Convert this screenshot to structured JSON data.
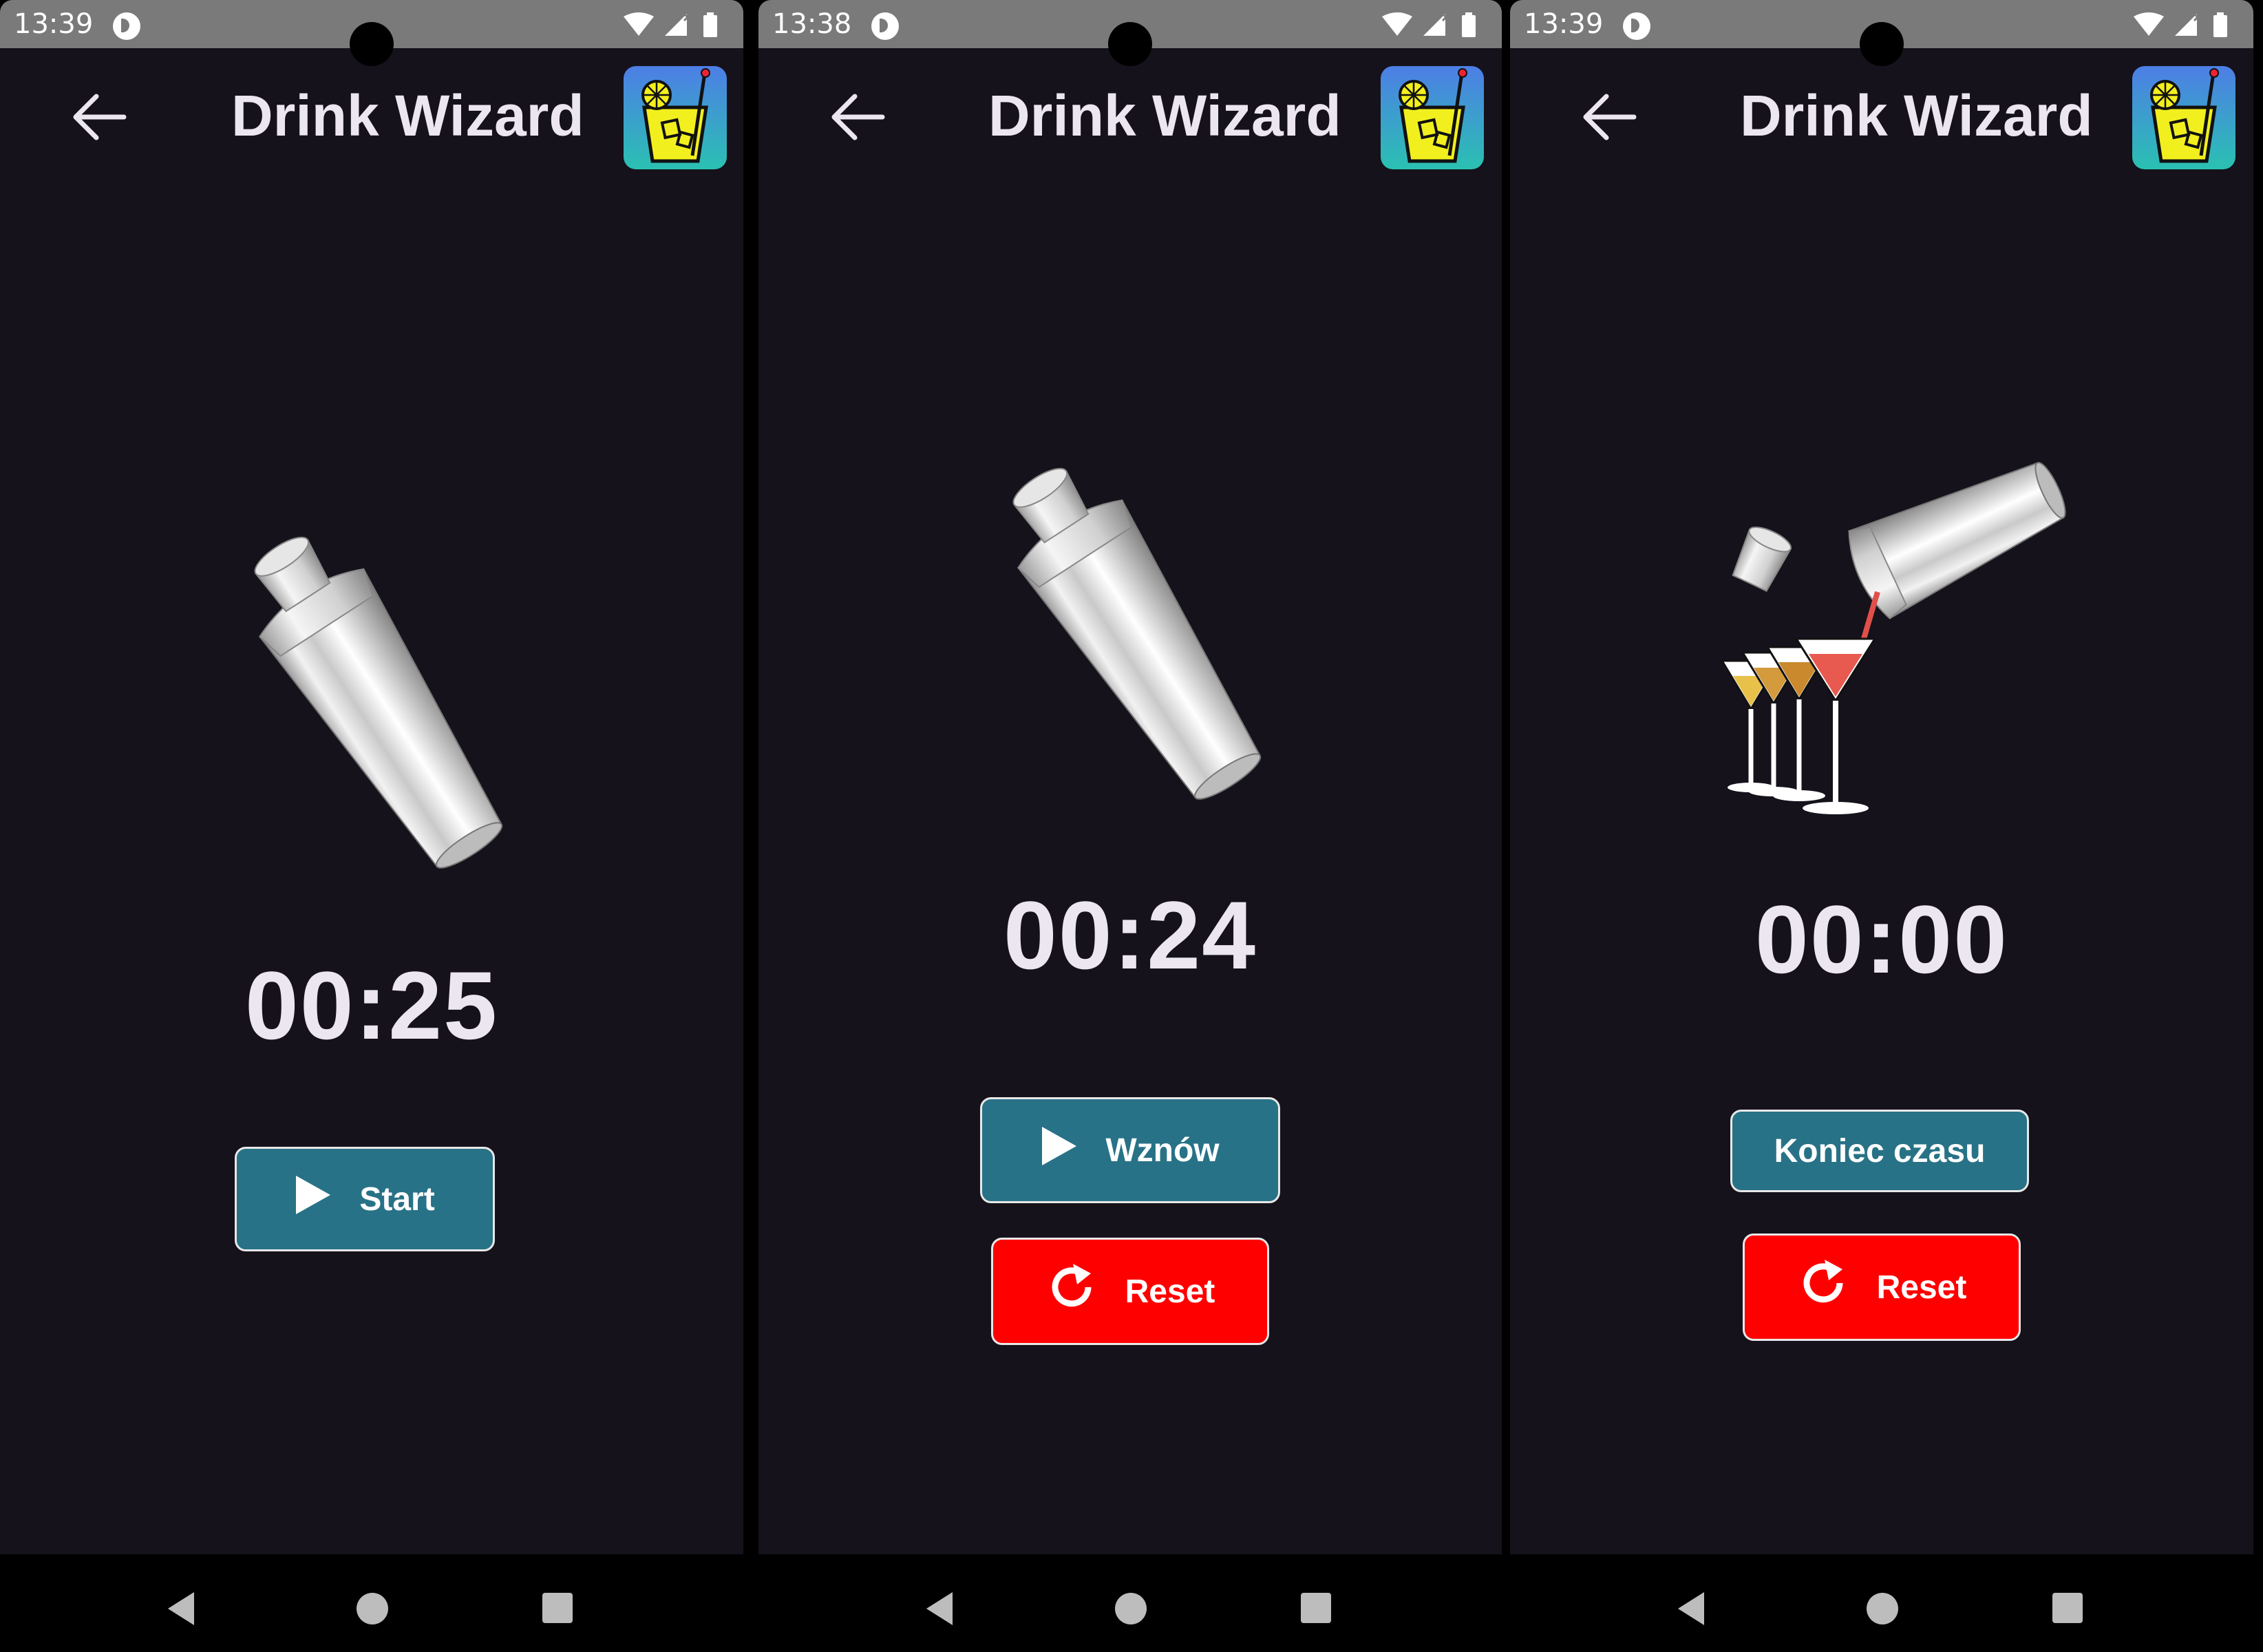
{
  "app": {
    "title": "Drink Wizard"
  },
  "screens": [
    {
      "status_time": "13:39",
      "timer": "00:25",
      "primary_label": "Start",
      "primary_progress": "idle",
      "image": "shaker"
    },
    {
      "status_time": "13:38",
      "timer": "00:24",
      "primary_label": "Wznów",
      "secondary_label": "Reset",
      "image": "shaker"
    },
    {
      "status_time": "13:39",
      "timer": "00:00",
      "primary_label": "Koniec czasu",
      "secondary_label": "Reset",
      "image": "pouring-cocktails"
    }
  ],
  "icons": {
    "back": "arrow-left-icon",
    "logo": "cocktail-glass-logo",
    "play": "play-icon",
    "reset": "refresh-icon",
    "wifi": "wifi-icon",
    "signal": "signal-icon",
    "battery": "battery-icon",
    "nav_back": "nav-back-icon",
    "nav_home": "nav-home-icon",
    "nav_recent": "nav-recent-icon"
  },
  "colors": {
    "background": "#15121b",
    "primary_button": "#287287",
    "reset_button": "#ff0000",
    "status_bar": "#7a7a7a",
    "text": "#ece6f0"
  }
}
